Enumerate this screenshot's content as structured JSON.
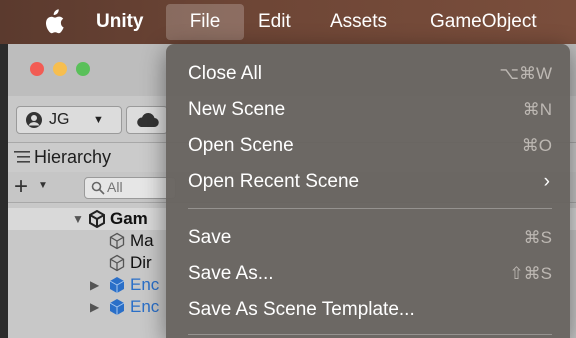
{
  "menubar": {
    "app_name": "Unity",
    "items": [
      "File",
      "Edit",
      "Assets",
      "GameObject"
    ]
  },
  "toolbar": {
    "account_label": "JG"
  },
  "hierarchy": {
    "tab_label": "Hierarchy",
    "search_placeholder": "All",
    "rows": [
      "Gam",
      "Ma",
      "Dir",
      "Enc",
      "Enc"
    ]
  },
  "file_menu": {
    "items": [
      {
        "label": "Close All",
        "shortcut": "⌥⌘W"
      },
      {
        "label": "New Scene",
        "shortcut": "⌘N"
      },
      {
        "label": "Open Scene",
        "shortcut": "⌘O"
      },
      {
        "label": "Open Recent Scene",
        "submenu": "›"
      },
      {
        "label": "Save",
        "shortcut": "⌘S"
      },
      {
        "label": "Save As...",
        "shortcut": "⇧⌘S"
      },
      {
        "label": "Save As Scene Template..."
      }
    ]
  },
  "colors": {
    "menubar": "#6e4636",
    "menu_bg": "#68645f",
    "entity_blue": "#2a6fc8"
  },
  "icons": [
    "apple-icon",
    "account-icon",
    "cloud-icon",
    "hierarchy-list-icon",
    "search-icon",
    "cube-icon",
    "unity-logo-icon",
    "chevron-right-icon"
  ]
}
